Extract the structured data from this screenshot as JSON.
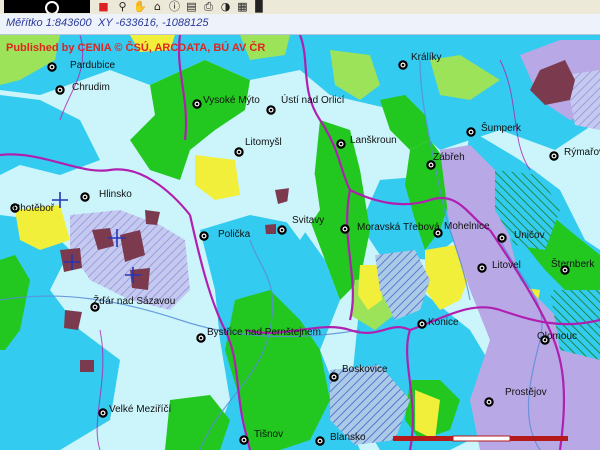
{
  "toolbar": {
    "icons": [
      "logo-icon",
      "layer-icon",
      "zoom-icon",
      "pan-icon",
      "home-icon",
      "info-icon",
      "legend-icon",
      "print-icon",
      "identify-icon",
      "zoom-extent-icon",
      "export-icon"
    ]
  },
  "status": {
    "scale": "Měřítko 1:843600",
    "coords": "XY -633616, -1088125"
  },
  "map": {
    "attribution": "Published by CENIA   © ČSÚ, ARCDATA, BÚ AV ČR",
    "colors": {
      "light_cyan": "#ccf5fb",
      "cyan": "#33cbef",
      "green": "#22c71f",
      "light_green": "#9ce35a",
      "yellow": "#f1ef3a",
      "lavender": "#b9a8e6",
      "maroon": "#7b3a4e",
      "border": "#b020b0"
    },
    "cities": [
      {
        "id": "pardubice",
        "name": "Pardubice"
      },
      {
        "id": "chrudim",
        "name": "Chrudim"
      },
      {
        "id": "vysoke-myto",
        "name": "Vysoké Mýto"
      },
      {
        "id": "usti",
        "name": "Ústí nad Orlicí"
      },
      {
        "id": "litomysl",
        "name": "Litomyšl"
      },
      {
        "id": "lanskroun",
        "name": "Lanškroun"
      },
      {
        "id": "zabreh",
        "name": "Zábřeh"
      },
      {
        "id": "sumperk",
        "name": "Šumperk"
      },
      {
        "id": "rymarov",
        "name": "Rýmařov"
      },
      {
        "id": "kraliky",
        "name": "Králíky"
      },
      {
        "id": "hlinsko",
        "name": "Hlinsko"
      },
      {
        "id": "chotebor",
        "name": "Chotěboř"
      },
      {
        "id": "policka",
        "name": "Polička"
      },
      {
        "id": "svitavy",
        "name": "Svitavy"
      },
      {
        "id": "moravska-trebova",
        "name": "Moravská Třebová"
      },
      {
        "id": "mohelnice",
        "name": "Mohelnice"
      },
      {
        "id": "unicov",
        "name": "Uničov"
      },
      {
        "id": "sternberk",
        "name": "Šternberk"
      },
      {
        "id": "litovel",
        "name": "Litovel"
      },
      {
        "id": "zdar",
        "name": "Žďár nad Sázavou"
      },
      {
        "id": "bystrice",
        "name": "Bystřice nad Pernštejnem"
      },
      {
        "id": "konice",
        "name": "Konice"
      },
      {
        "id": "olomouc",
        "name": "Olomouc"
      },
      {
        "id": "boskovice",
        "name": "Boskovice"
      },
      {
        "id": "prostejov",
        "name": "Prostějov"
      },
      {
        "id": "velke-mezirici",
        "name": "Velké Meziříčí"
      },
      {
        "id": "tisnov",
        "name": "Tišnov"
      },
      {
        "id": "blansko",
        "name": "Blansko"
      }
    ]
  }
}
